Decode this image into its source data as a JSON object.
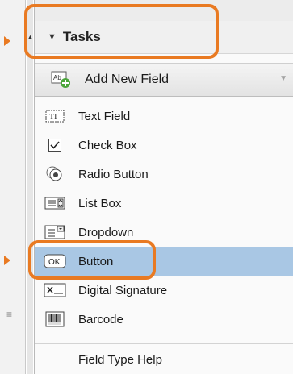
{
  "tasks_header": {
    "title": "Tasks"
  },
  "add_field": {
    "label": "Add New Field"
  },
  "menu_items": [
    {
      "label": "Text Field",
      "icon": "text-field-icon",
      "selected": false
    },
    {
      "label": "Check Box",
      "icon": "checkbox-icon",
      "selected": false
    },
    {
      "label": "Radio Button",
      "icon": "radio-button-icon",
      "selected": false
    },
    {
      "label": "List Box",
      "icon": "list-box-icon",
      "selected": false
    },
    {
      "label": "Dropdown",
      "icon": "dropdown-icon",
      "selected": false
    },
    {
      "label": "Button",
      "icon": "button-icon",
      "icon_text": "OK",
      "selected": true
    },
    {
      "label": "Digital Signature",
      "icon": "digital-signature-icon",
      "selected": false
    },
    {
      "label": "Barcode",
      "icon": "barcode-icon",
      "selected": false
    }
  ],
  "help": {
    "label": "Field Type Help"
  },
  "colors": {
    "highlight": "#e97a22",
    "selected_row": "#a9c7e4"
  }
}
